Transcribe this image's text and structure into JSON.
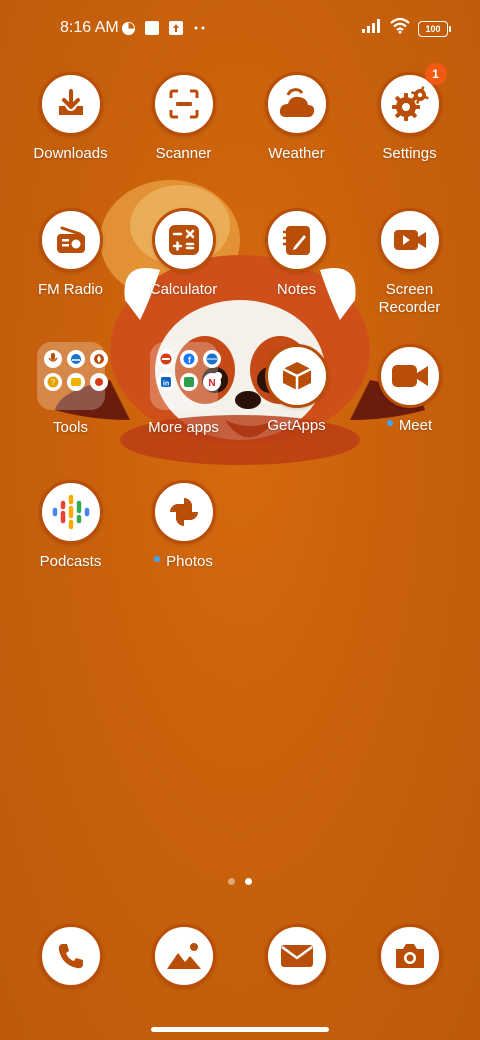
{
  "status_bar": {
    "time": "8:16 AM",
    "battery": "100",
    "left_icons": [
      "data-saver-icon",
      "square-notification-icon",
      "upload-notification-icon",
      "more-notifications-icon"
    ],
    "right_icons": [
      "signal-icon",
      "wifi-icon",
      "battery-icon"
    ]
  },
  "apps": [
    {
      "label": "Downloads",
      "icon": "download-icon"
    },
    {
      "label": "Scanner",
      "icon": "scanner-icon"
    },
    {
      "label": "Weather",
      "icon": "weather-icon"
    },
    {
      "label": "Settings",
      "icon": "gear-icon",
      "badge": "1"
    },
    {
      "label": "FM Radio",
      "icon": "radio-icon"
    },
    {
      "label": "Calculator",
      "icon": "calculator-icon"
    },
    {
      "label": "Notes",
      "icon": "notes-icon"
    },
    {
      "label": "Screen\nRecorder",
      "icon": "screen-recorder-icon"
    },
    {
      "label": "Tools",
      "icon": "folder-icon"
    },
    {
      "label": "More apps",
      "icon": "folder-icon"
    },
    {
      "label": "GetApps",
      "icon": "getapps-icon"
    },
    {
      "label": "Meet",
      "icon": "video-camera-icon"
    },
    {
      "label": "Podcasts",
      "icon": "podcasts-icon"
    },
    {
      "label": "Photos",
      "icon": "photos-icon"
    }
  ],
  "dock": [
    {
      "name": "Phone",
      "icon": "phone-icon"
    },
    {
      "name": "Gallery",
      "icon": "gallery-icon"
    },
    {
      "name": "Mail",
      "icon": "mail-icon"
    },
    {
      "name": "Camera",
      "icon": "camera-icon"
    }
  ],
  "page_indicator": {
    "pages": 2,
    "current": 2
  },
  "colors": {
    "accent": "#b84e08",
    "wallpaper": "#c9610c",
    "badge": "#f25a13",
    "new_dot": "#3ea6ff"
  }
}
